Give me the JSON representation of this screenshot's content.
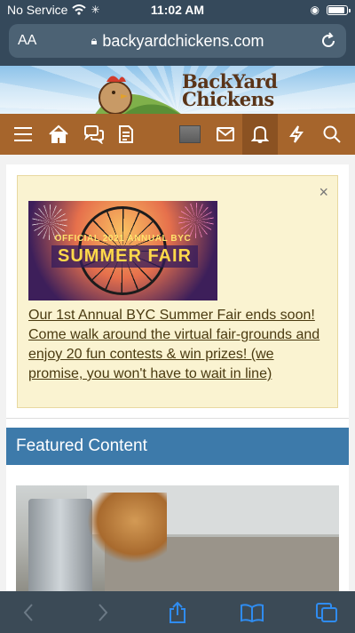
{
  "status": {
    "carrier": "No Service",
    "time": "11:02 AM"
  },
  "browser": {
    "text_size": "AA",
    "url": "backyardchickens.com"
  },
  "site": {
    "logo_line1": "BackYard",
    "logo_line2": "Chickens"
  },
  "nav": {
    "icons": [
      "menu-icon",
      "home-icon",
      "chat-icon",
      "document-icon",
      "avatar",
      "mail-icon",
      "bell-icon",
      "lightning-icon",
      "search-icon"
    ]
  },
  "notice": {
    "close": "×",
    "banner_line1": "OFFICIAL 2021 ANNUAL BYC",
    "banner_line2": "SUMMER FAIR",
    "text": "Our 1st Annual BYC Summer Fair ends soon! Come walk around the virtual fair-grounds and enjoy 20 fun contests & win prizes! (we promise, you won't have to wait in line)"
  },
  "featured": {
    "title": "Featured Content"
  },
  "colors": {
    "nav": "#a6652c",
    "featured": "#3d7aaa",
    "notice_bg": "#faf3d1",
    "ios_bar": "#35495b"
  }
}
